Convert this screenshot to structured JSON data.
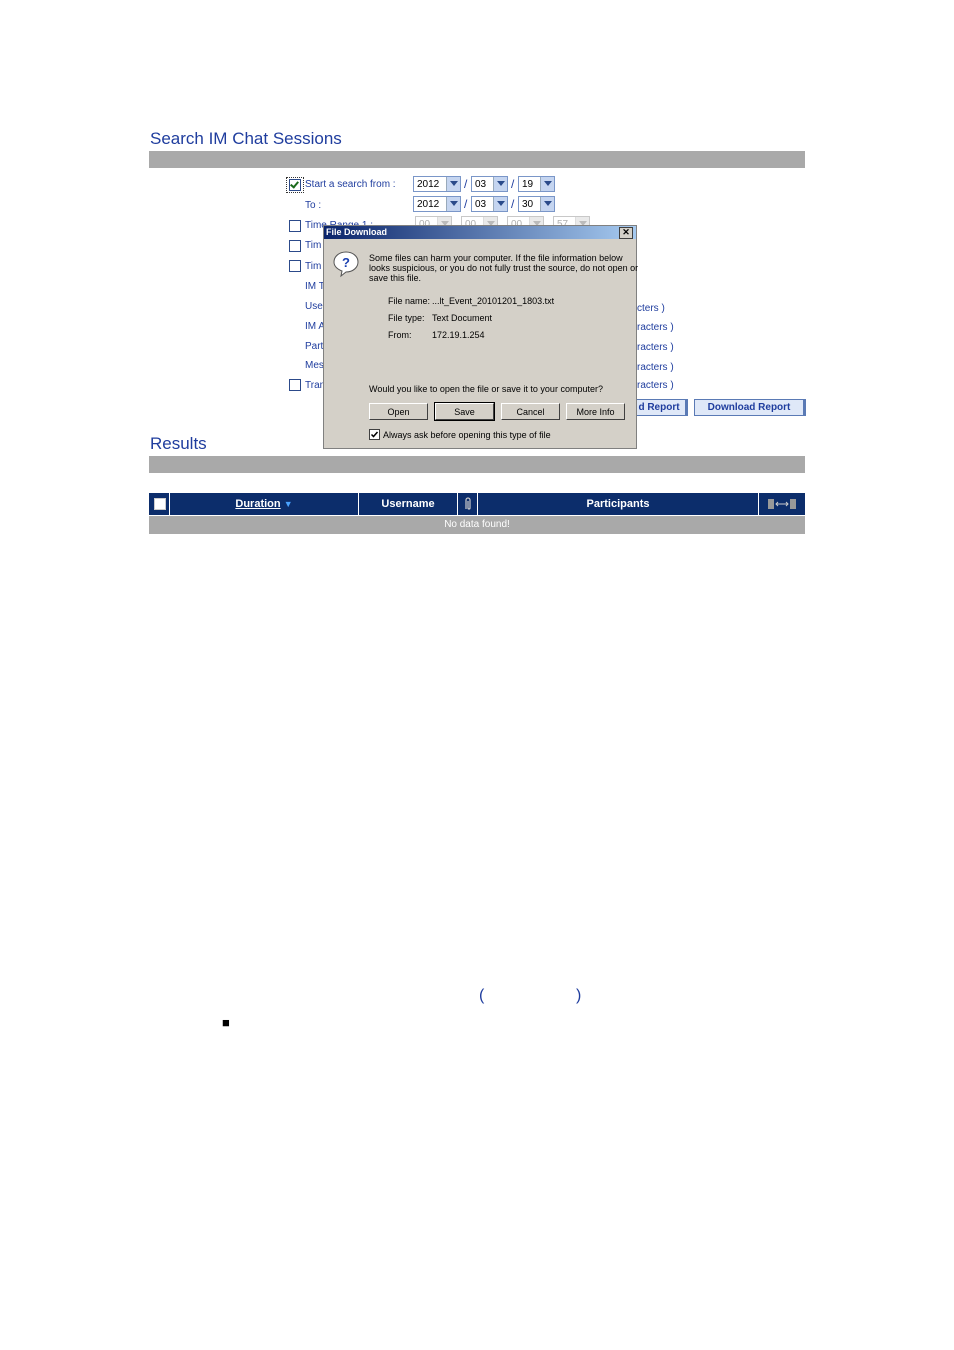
{
  "search": {
    "title": "Search IM Chat Sessions",
    "start_label": "Start a search from :",
    "to_label": "To :",
    "from_date": {
      "year": "2012",
      "month": "03",
      "day": "19"
    },
    "to_date": {
      "year": "2012",
      "month": "03",
      "day": "30"
    },
    "time_range_label": "Time Range 1 :",
    "time_range_values": {
      "a": "00",
      "b": "00",
      "c": "00",
      "d": "57"
    },
    "row_time2": "Tim",
    "row_time3": "Tim",
    "row_im_type": "IM T",
    "row_user": "User",
    "row_im_account": "IM A",
    "row_participants": "Part",
    "row_message": "Mes",
    "row_transfer": "Tran",
    "hint_1": "cters )",
    "hint_2": "racters )",
    "hint_3": "racters )",
    "hint_4": "racters )",
    "hint_5": "racters )",
    "partial_report_button": "d Report",
    "download_report_button": "Download Report"
  },
  "results": {
    "title": "Results",
    "columns": [
      "Duration",
      "Username",
      "Participants"
    ],
    "sort_arrow": "▼",
    "empty_message": "No data found!"
  },
  "dialog": {
    "title": "File Download",
    "close": "✕",
    "warning": [
      "Some files can harm your computer. If the file information below",
      "looks suspicious, or you do not fully trust the source, do not open or",
      "save this file."
    ],
    "file_name_label": "File name:",
    "file_name": "...lt_Event_20101201_1803.txt",
    "file_type_label": "File type:",
    "file_type": "Text Document",
    "from_label": "From:",
    "from": "172.19.1.254",
    "question": "Would you like to open the file or save it to your computer?",
    "buttons": {
      "open": "Open",
      "save": "Save",
      "cancel": "Cancel",
      "more": "More Info"
    },
    "always_ask": "Always ask before opening this type of file"
  },
  "footer": {
    "paren_left": "(",
    "paren_right": ")",
    "bullet": "■"
  }
}
